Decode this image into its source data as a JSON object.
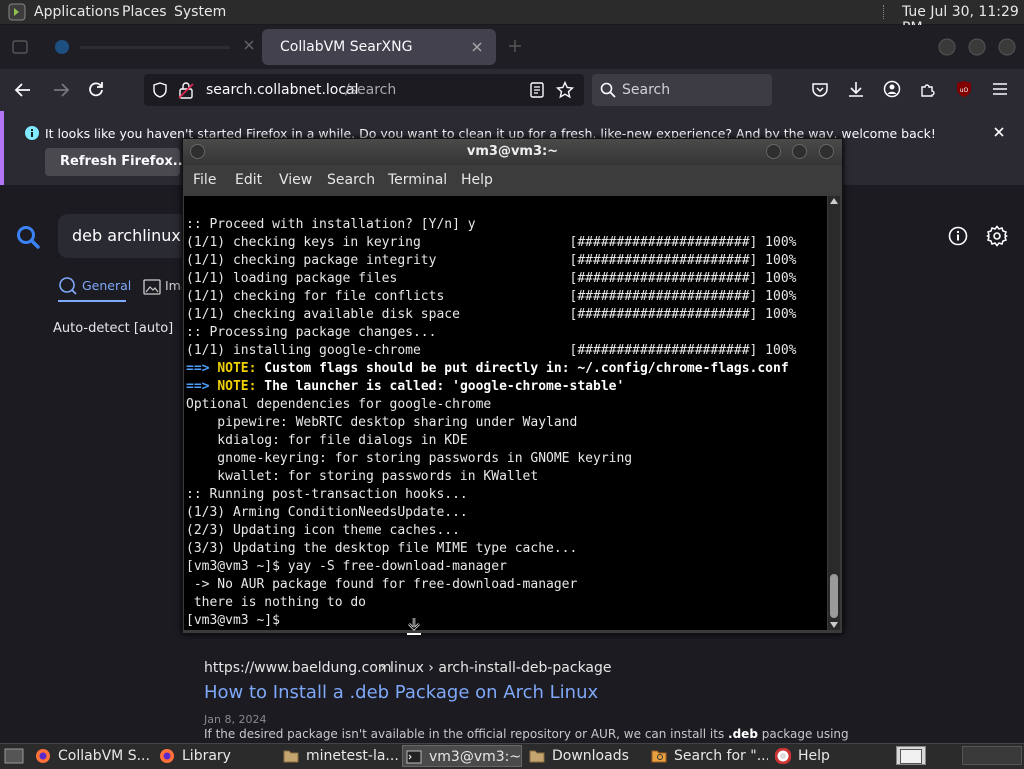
{
  "top_panel": {
    "applications": "Applications",
    "places": "Places",
    "system": "System",
    "clock": "Tue Jul 30, 11:29 PM"
  },
  "firefox": {
    "tabs": [
      {
        "label": "",
        "active": false
      },
      {
        "label": "CollabVM SearXNG",
        "active": true
      }
    ],
    "url": {
      "domain": "search.collabnet.local",
      "path": "/search"
    },
    "search_placeholder": "Search",
    "notification": {
      "text": "It looks like you haven't started Firefox in a while. Do you want to clean it up for a fresh, like-new experience? And by the way, welcome back!",
      "button": "Refresh Firefox..."
    }
  },
  "searxng": {
    "query": "deb archlinux",
    "tabs": {
      "general": "General",
      "images": "Ima"
    },
    "language": "Auto-detect [auto]",
    "result": {
      "url_host": "https://www.baeldung.com",
      "url_path": "› linux › arch-install-deb-package",
      "title": "How to Install a .deb Package on Arch Linux",
      "date": "Jan 8, 2024",
      "snippet_prefix": "If the desired package isn't available in the official repository or AUR, we can install its ",
      "snippet_bold": ".deb",
      "snippet_suffix": " package using"
    }
  },
  "terminal": {
    "title": "vm3@vm3:~",
    "menu": [
      "File",
      "Edit",
      "View",
      "Search",
      "Terminal",
      "Help"
    ],
    "lines": [
      ":: Proceed with installation? [Y/n] y",
      "(1/1) checking keys in keyring                   [######################] 100%",
      "(1/1) checking package integrity                 [######################] 100%",
      "(1/1) loading package files                      [######################] 100%",
      "(1/1) checking for file conflicts                [######################] 100%",
      "(1/1) checking available disk space              [######################] 100%",
      ":: Processing package changes...",
      "(1/1) installing google-chrome                   [######################] 100%",
      "==> NOTE: Custom flags should be put directly in: ~/.config/chrome-flags.conf",
      "==> NOTE: The launcher is called: 'google-chrome-stable'",
      "Optional dependencies for google-chrome",
      "    pipewire: WebRTC desktop sharing under Wayland",
      "    kdialog: for file dialogs in KDE",
      "    gnome-keyring: for storing passwords in GNOME keyring",
      "    kwallet: for storing passwords in KWallet",
      ":: Running post-transaction hooks...",
      "(1/3) Arming ConditionNeedsUpdate...",
      "(2/3) Updating icon theme caches...",
      "(3/3) Updating the desktop file MIME type cache...",
      "[vm3@vm3 ~]$ yay -S free-download-manager",
      " -> No AUR package found for free-download-manager",
      " there is nothing to do",
      "[vm3@vm3 ~]$ "
    ]
  },
  "taskbar": {
    "items": [
      "CollabVM S...",
      "Library",
      "minetest-la...",
      "vm3@vm3:~",
      "Downloads",
      "Search for \"...",
      "Help"
    ]
  },
  "colors": {
    "accent_purple": "#b374f5",
    "link_blue": "#7ea8f8",
    "search_icon_blue": "#3b82f6",
    "terminal_note": "#f0d000",
    "terminal_arrow": "#4ea0ff"
  }
}
